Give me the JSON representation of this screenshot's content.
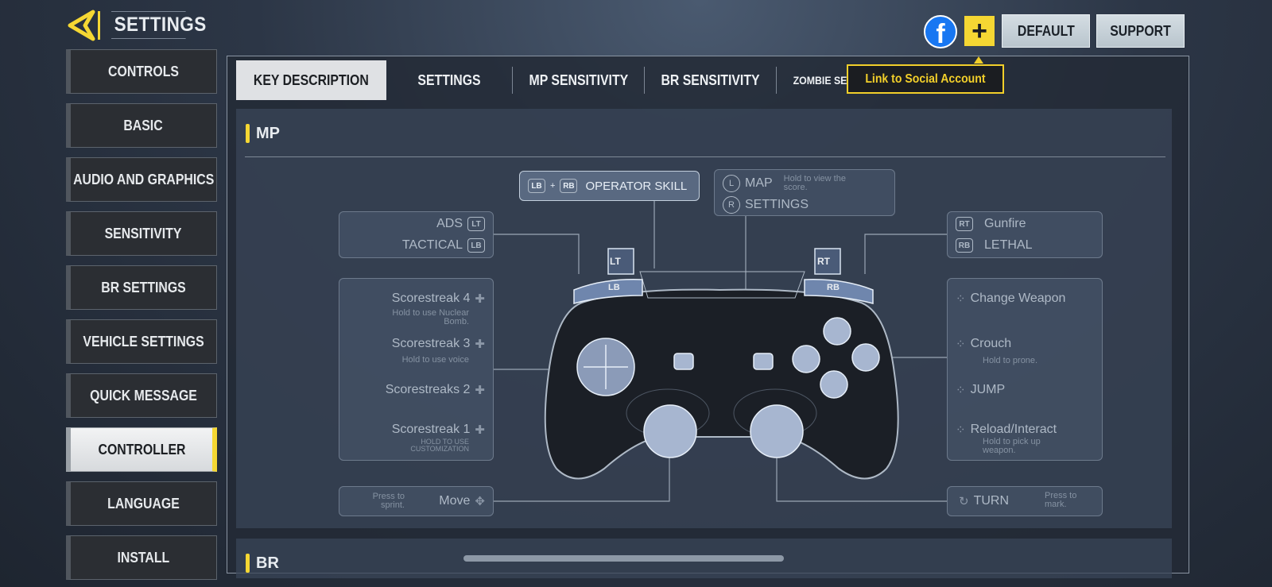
{
  "header": {
    "title": "SETTINGS",
    "back_icon": "back-arrow-icon"
  },
  "sidebar": {
    "items": [
      {
        "label": "CONTROLS"
      },
      {
        "label": "BASIC"
      },
      {
        "label": "AUDIO AND GRAPHICS"
      },
      {
        "label": "SENSITIVITY"
      },
      {
        "label": "BR SETTINGS"
      },
      {
        "label": "VEHICLE SETTINGS"
      },
      {
        "label": "QUICK MESSAGE"
      },
      {
        "label": "CONTROLLER",
        "active": true
      },
      {
        "label": "LANGUAGE"
      },
      {
        "label": "INSTALL"
      }
    ]
  },
  "topbar": {
    "facebook": "f",
    "plus": "+",
    "default_label": "DEFAULT",
    "support_label": "SUPPORT",
    "link_label": "Link to Social Account"
  },
  "tabs": [
    {
      "label": "KEY DESCRIPTION",
      "active": true
    },
    {
      "label": "SETTINGS"
    },
    {
      "label": "MP SENSITIVITY"
    },
    {
      "label": "BR SENSITIVITY"
    },
    {
      "label": "ZOMBIE SENSITIVITY"
    }
  ],
  "sections": {
    "mp": "MP",
    "br": "BR"
  },
  "controller": {
    "operator": {
      "k1": "LB",
      "plus": "+",
      "k2": "RB",
      "label": "OPERATOR SKILL"
    },
    "center": {
      "l_key": "L",
      "map": "MAP",
      "map_hint": "Hold to view the score.",
      "r_key": "R",
      "settings": "SETTINGS"
    },
    "left_triggers": {
      "ads": "ADS",
      "lt": "LT",
      "tactical": "TACTICAL",
      "lb": "LB"
    },
    "right_triggers": {
      "rt": "RT",
      "gunfire": "Gunfire",
      "rb": "RB",
      "lethal": "LETHAL"
    },
    "dpad": {
      "s4": "Scorestreak 4",
      "s4_hint": "Hold to use Nuclear Bomb.",
      "s3": "Scorestreak 3",
      "s3_hint": "Hold to use voice",
      "s2": "Scorestreaks 2",
      "s1": "Scorestreak 1",
      "s1_hint": "HOLD TO USE CUSTOMIZATION"
    },
    "face": {
      "y": "Change Weapon",
      "b": "Crouch",
      "b_hint": "Hold to prone.",
      "a": "JUMP",
      "x": "Reload/Interact",
      "x_hint": "Hold to pick up weapon."
    },
    "move": {
      "hint": "Press to sprint.",
      "label": "Move"
    },
    "turn": {
      "label": "TURN",
      "hint": "Press to mark."
    },
    "labels": {
      "lt": "LT",
      "lb": "LB",
      "rt": "RT",
      "rb": "RB"
    }
  },
  "colors": {
    "accent": "#f5d733",
    "facebook": "#1877f2"
  }
}
